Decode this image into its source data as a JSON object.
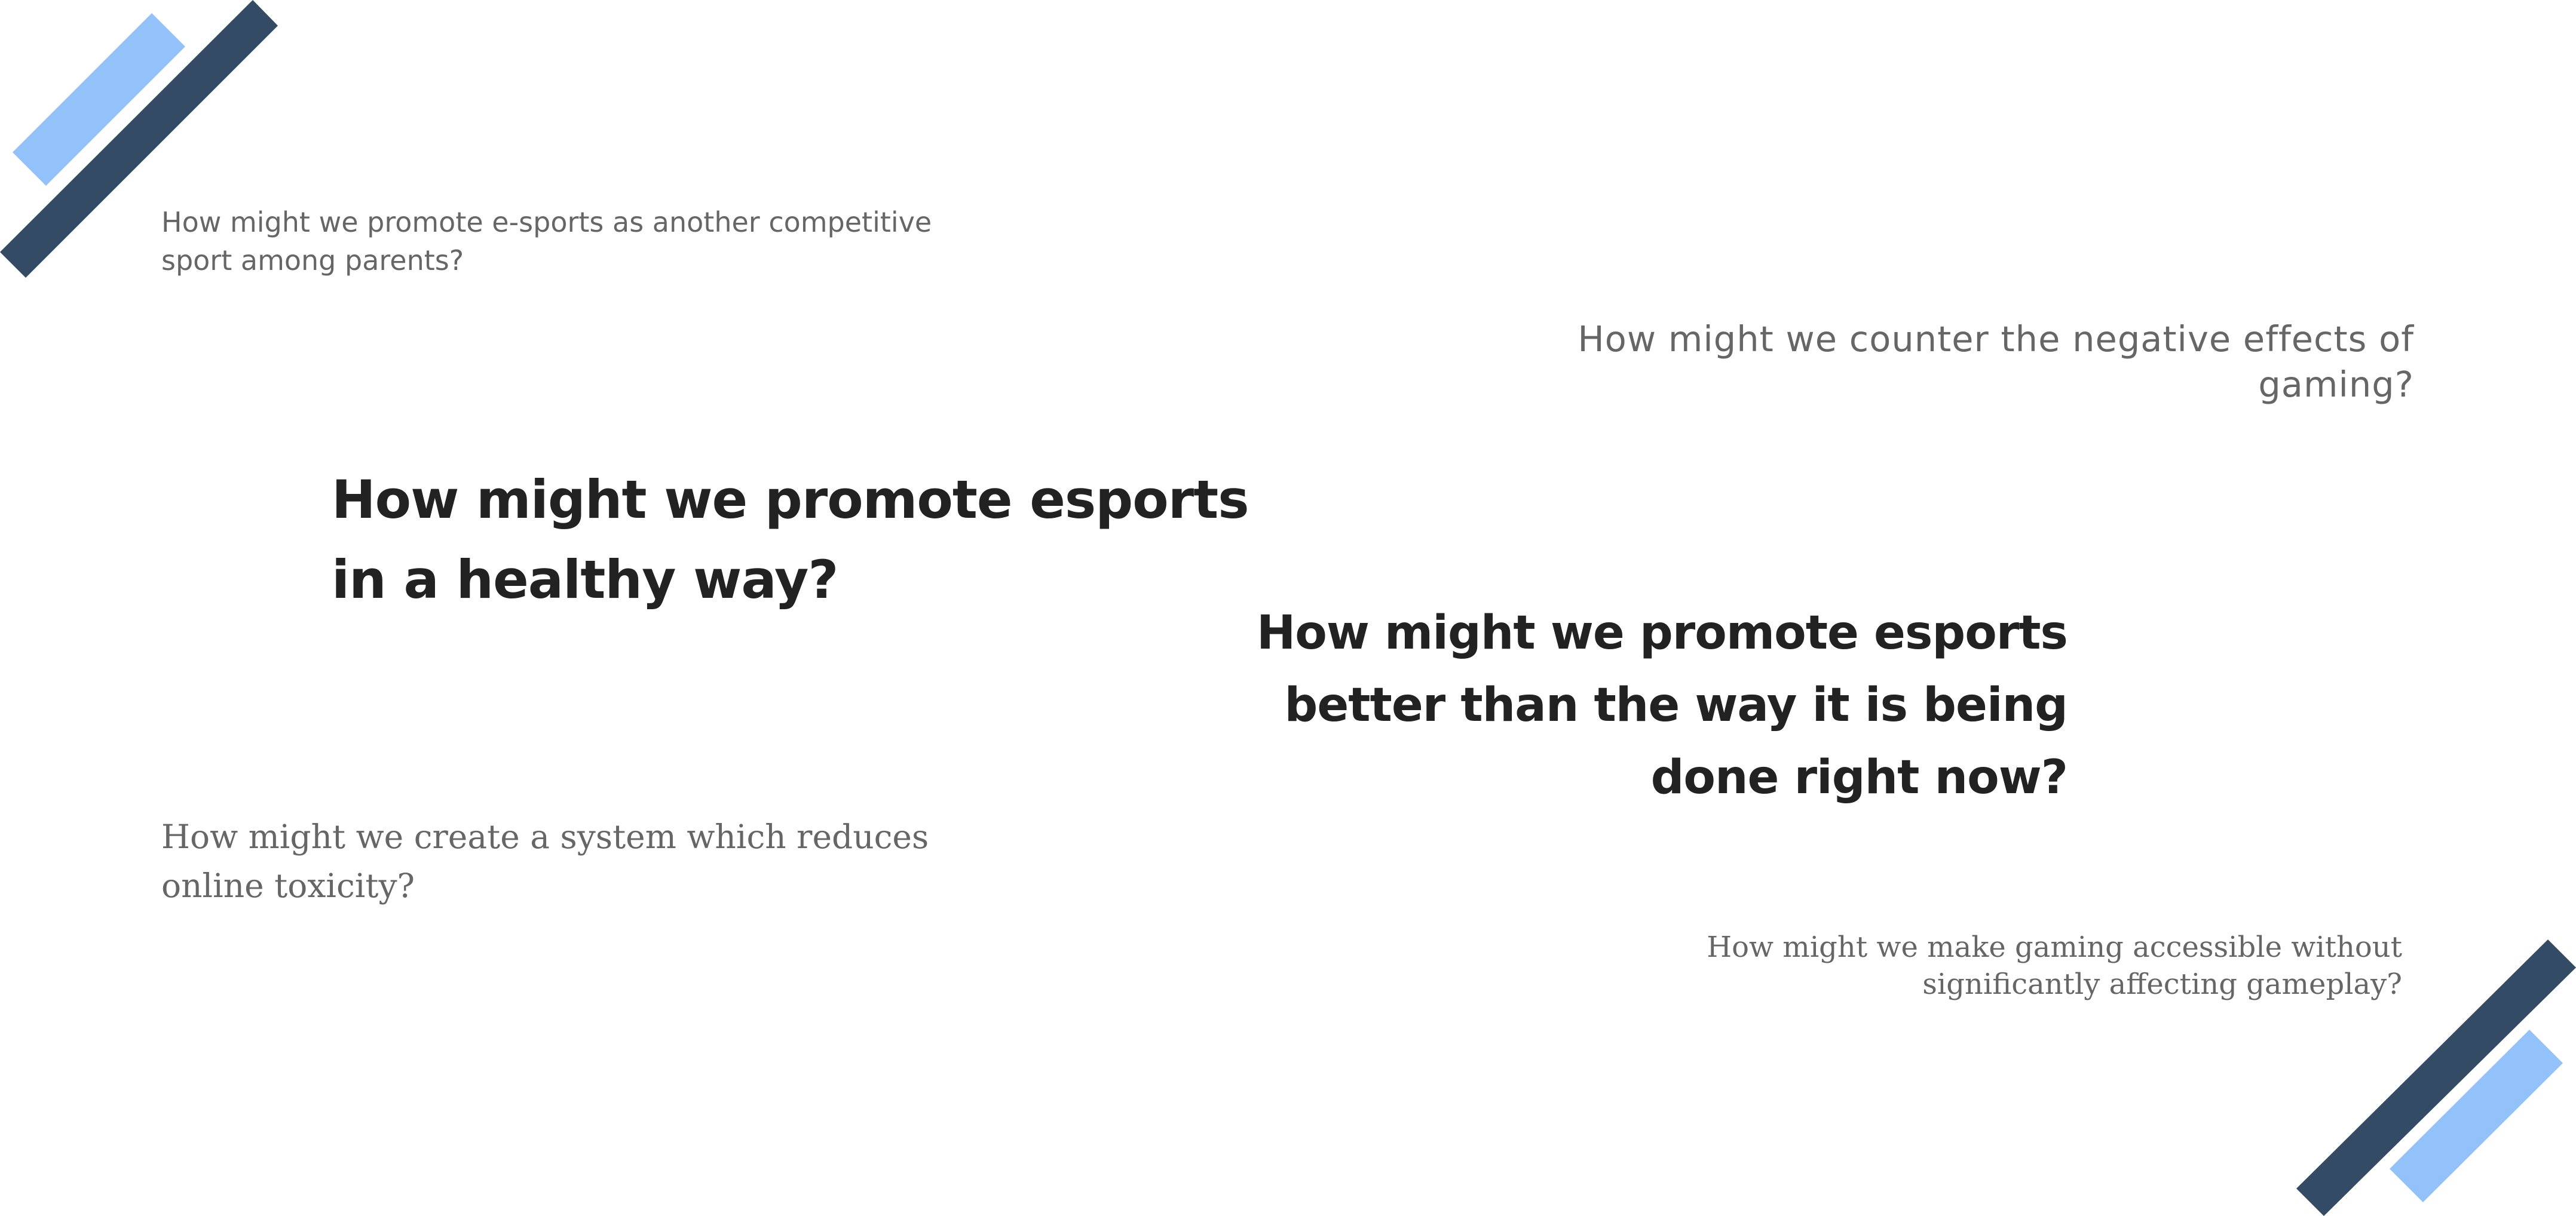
{
  "colors": {
    "light_stripe": "#93c2fb",
    "dark_stripe": "#344b66",
    "heading_text": "#222222",
    "body_text": "#666666"
  },
  "questions": {
    "esports_parents": "How might we promote e-sports as another competitive sport among parents?",
    "negative_effects": "How might we counter the negative effects of gaming?",
    "healthy_way": "How might we promote esports in a healthy way?",
    "better_way": "How might we promote esports better than the way it is being done right now?",
    "online_toxicity": "How might we create a system which reduces online toxicity?",
    "accessible_gaming": "How might we make gaming accessible without significantly affecting gameplay?"
  }
}
